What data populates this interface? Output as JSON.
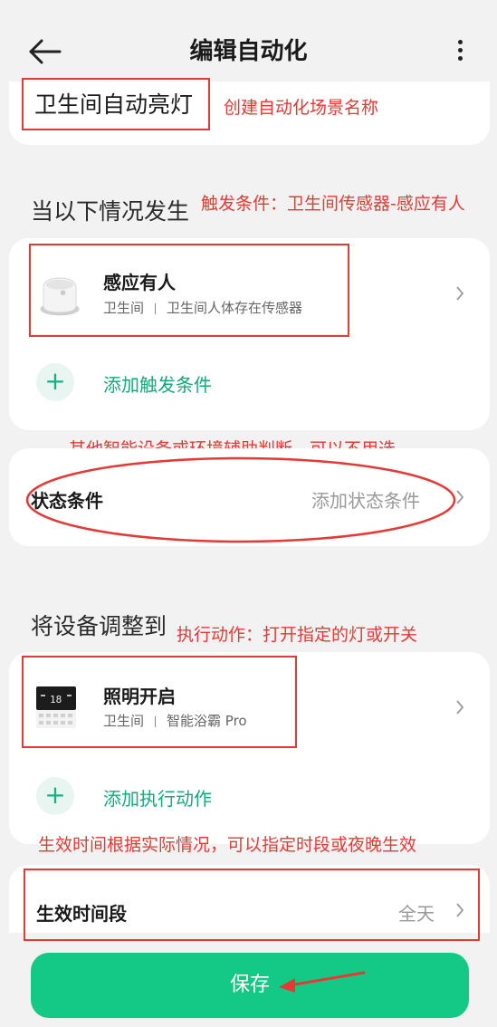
{
  "header": {
    "title": "编辑自动化"
  },
  "scene": {
    "name": "卫生间自动亮灯"
  },
  "trigger_section": {
    "title": "当以下情况发生",
    "item": {
      "title": "感应有人",
      "room": "卫生间",
      "device": "卫生间人体存在传感器",
      "icon": "motion-sensor-icon"
    },
    "add_label": "添加触发条件"
  },
  "status_condition": {
    "label": "状态条件",
    "value": "添加状态条件"
  },
  "action_section": {
    "title": "将设备调整到",
    "item": {
      "title": "照明开启",
      "room": "卫生间",
      "device": "智能浴霸 Pro",
      "icon": "bath-heater-icon"
    },
    "add_label": "添加执行动作"
  },
  "effective_time": {
    "label": "生效时间段",
    "value": "全天"
  },
  "save_label": "保存",
  "annotations": {
    "scene_name": "创建自动化场景名称",
    "trigger": "触发条件：卫生间传感器-感应有人",
    "trigger_line2": "有人",
    "status": "其他智能设备或环境辅助判断，可以不用选",
    "action": "执行动作：打开指定的灯或开关",
    "time": "生效时间根据实际情况，可以指定时段或夜晚生效"
  },
  "colors": {
    "accent": "#14c985",
    "accent_text": "#15a87a",
    "annotation": "#e53935",
    "background": "#f2f2f2"
  }
}
